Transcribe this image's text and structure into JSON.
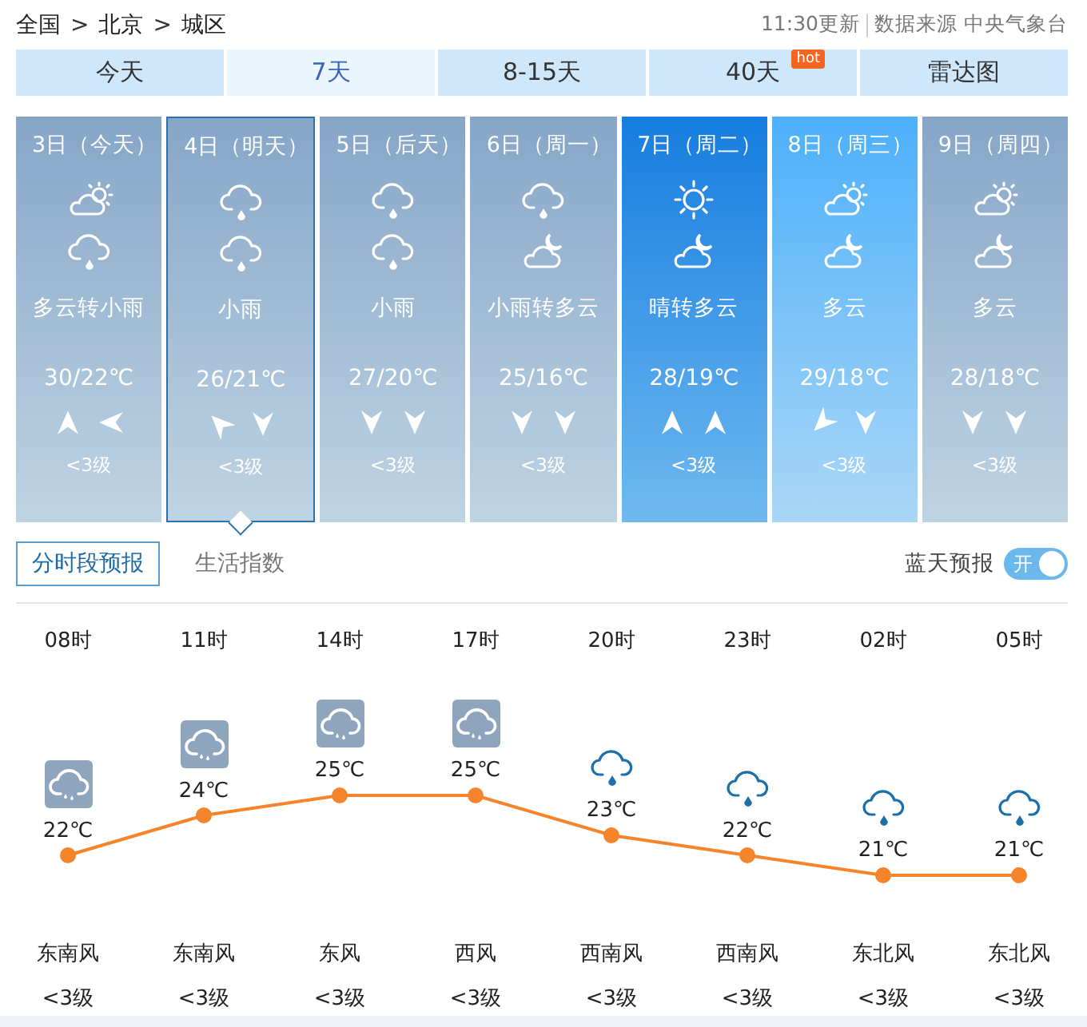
{
  "breadcrumb": {
    "separator": ">",
    "items": [
      "全国",
      "北京",
      "城区"
    ]
  },
  "update_time": "11:30更新",
  "source": "数据来源 中央气象台",
  "tabs": [
    {
      "label": "今天",
      "selected": false
    },
    {
      "label": "7天",
      "selected": true
    },
    {
      "label": "8-15天",
      "selected": false
    },
    {
      "label": "40天",
      "selected": false,
      "badge": "hot"
    },
    {
      "label": "雷达图",
      "selected": false
    }
  ],
  "days": [
    {
      "date": "3日（今天）",
      "icons": [
        {
          "kind": "cloud-sun"
        },
        {
          "kind": "rain"
        }
      ],
      "weather": "多云转小雨",
      "temp": "30/22℃",
      "arrows": [
        {
          "kind": "up"
        },
        {
          "kind": "left"
        }
      ],
      "wind": "<3级",
      "kind": "muted",
      "selected": false
    },
    {
      "date": "4日（明天）",
      "icons": [
        {
          "kind": "rain"
        },
        {
          "kind": "rain"
        }
      ],
      "weather": "小雨",
      "temp": "26/21℃",
      "arrows": [
        {
          "kind": "upleft"
        },
        {
          "kind": "down"
        }
      ],
      "wind": "<3级",
      "kind": "muted",
      "selected": true
    },
    {
      "date": "5日（后天）",
      "icons": [
        {
          "kind": "rain"
        },
        {
          "kind": "rain"
        }
      ],
      "weather": "小雨",
      "temp": "27/20℃",
      "arrows": [
        {
          "kind": "down"
        },
        {
          "kind": "down"
        }
      ],
      "wind": "<3级",
      "kind": "muted",
      "selected": false
    },
    {
      "date": "6日（周一）",
      "icons": [
        {
          "kind": "rain"
        },
        {
          "kind": "cloud-moon"
        }
      ],
      "weather": "小雨转多云",
      "temp": "25/16℃",
      "arrows": [
        {
          "kind": "down"
        },
        {
          "kind": "down"
        }
      ],
      "wind": "<3级",
      "kind": "muted",
      "selected": false
    },
    {
      "date": "7日（周二）",
      "icons": [
        {
          "kind": "sun"
        },
        {
          "kind": "cloud-moon"
        }
      ],
      "weather": "晴转多云",
      "temp": "28/19℃",
      "arrows": [
        {
          "kind": "up"
        },
        {
          "kind": "up"
        }
      ],
      "wind": "<3级",
      "kind": "deep",
      "selected": false
    },
    {
      "date": "8日（周三）",
      "icons": [
        {
          "kind": "cloud-sun"
        },
        {
          "kind": "cloud-moon"
        }
      ],
      "weather": "多云",
      "temp": "29/18℃",
      "arrows": [
        {
          "kind": "downleft"
        },
        {
          "kind": "down"
        }
      ],
      "wind": "<3级",
      "kind": "light",
      "selected": false
    },
    {
      "date": "9日（周四）",
      "icons": [
        {
          "kind": "cloud-sun"
        },
        {
          "kind": "cloud-moon"
        }
      ],
      "weather": "多云",
      "temp": "28/18℃",
      "arrows": [
        {
          "kind": "down"
        },
        {
          "kind": "down"
        }
      ],
      "wind": "<3级",
      "kind": "muted",
      "selected": false
    }
  ],
  "subtabs": [
    {
      "label": "分时段预报",
      "selected": true
    },
    {
      "label": "生活指数",
      "selected": false
    }
  ],
  "toggle": {
    "label": "蓝天预报",
    "text": "开",
    "on": true
  },
  "hourly": [
    {
      "kind": "rain-box",
      "wind": "东南风",
      "level": "<3级"
    },
    {
      "kind": "rain-box",
      "wind": "东南风",
      "level": "<3级"
    },
    {
      "kind": "rain-box",
      "wind": "东风",
      "level": "<3级"
    },
    {
      "kind": "rain-box",
      "wind": "西风",
      "level": "<3级"
    },
    {
      "kind": "rain",
      "wind": "西南风",
      "level": "<3级"
    },
    {
      "kind": "rain",
      "wind": "西南风",
      "level": "<3级"
    },
    {
      "kind": "rain",
      "wind": "东北风",
      "level": "<3级"
    },
    {
      "kind": "rain",
      "wind": "东北风",
      "level": "<3级"
    }
  ],
  "chart_data": {
    "type": "line",
    "categories": [
      "08时",
      "11时",
      "14时",
      "17时",
      "20时",
      "23时",
      "02时",
      "05时"
    ],
    "series": [
      {
        "color": "#f5842a",
        "marker": "circle",
        "values": [
          22,
          24,
          25,
          25,
          23,
          22,
          21,
          21
        ]
      }
    ],
    "data_labels": true
  },
  "temperature_unit": "℃"
}
